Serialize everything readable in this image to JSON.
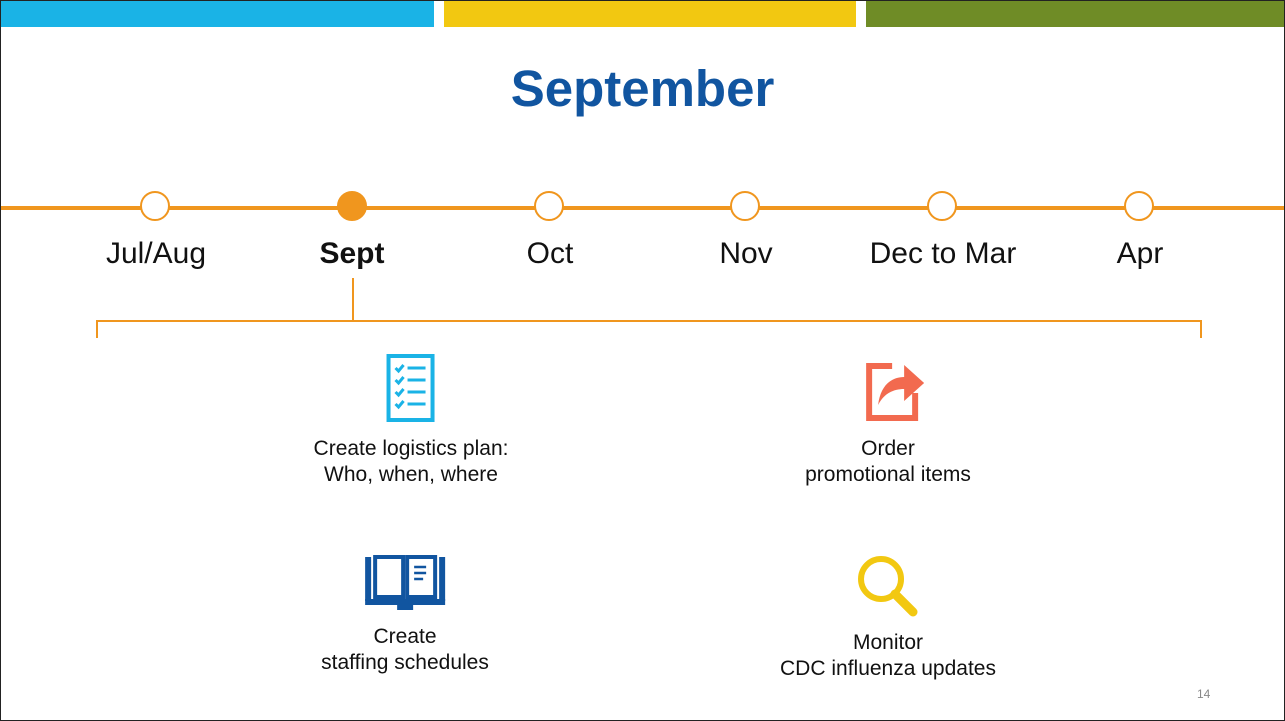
{
  "title": "September",
  "timeline": {
    "months": [
      {
        "label": "Jul/Aug",
        "active": false
      },
      {
        "label": "Sept",
        "active": true
      },
      {
        "label": "Oct",
        "active": false
      },
      {
        "label": "Nov",
        "active": false
      },
      {
        "label": "Dec to Mar",
        "active": false
      },
      {
        "label": "Apr",
        "active": false
      }
    ]
  },
  "tasks": [
    {
      "icon": "checklist-icon",
      "line1": "Create logistics plan:",
      "line2": "Who, when, where"
    },
    {
      "icon": "share-icon",
      "line1": "Order",
      "line2": "promotional items"
    },
    {
      "icon": "book-icon",
      "line1": "Create",
      "line2": "staffing schedules"
    },
    {
      "icon": "search-icon",
      "line1": "Monitor",
      "line2": "CDC influenza updates"
    }
  ],
  "page_number": "14",
  "colors": {
    "title": "#1155a0",
    "timeline": "#f0961e",
    "bar_blue": "#1ab3e6",
    "bar_yellow": "#f2c811",
    "bar_green": "#6f8c26"
  }
}
